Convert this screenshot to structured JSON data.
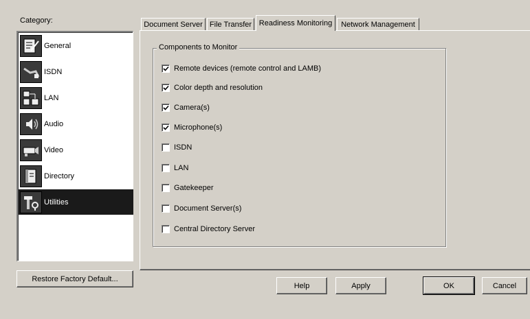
{
  "category": {
    "label": "Category:",
    "items": [
      {
        "label": "General",
        "icon": "general-icon",
        "selected": false
      },
      {
        "label": "ISDN",
        "icon": "isdn-icon",
        "selected": false
      },
      {
        "label": "LAN",
        "icon": "lan-icon",
        "selected": false
      },
      {
        "label": "Audio",
        "icon": "audio-icon",
        "selected": false
      },
      {
        "label": "Video",
        "icon": "video-icon",
        "selected": false
      },
      {
        "label": "Directory",
        "icon": "directory-icon",
        "selected": false
      },
      {
        "label": "Utilities",
        "icon": "utilities-icon",
        "selected": true
      }
    ],
    "restore_label": "Restore Factory Default..."
  },
  "tabs": [
    {
      "label": "Document Server",
      "active": false
    },
    {
      "label": "File Transfer",
      "active": false
    },
    {
      "label": "Readiness Monitoring",
      "active": true
    },
    {
      "label": "Network Management",
      "active": false
    }
  ],
  "group": {
    "title": "Components to Monitor",
    "items": [
      {
        "label": "Remote devices (remote control and LAMB)",
        "checked": true
      },
      {
        "label": "Color depth and resolution",
        "checked": true
      },
      {
        "label": "Camera(s)",
        "checked": true
      },
      {
        "label": "Microphone(s)",
        "checked": true
      },
      {
        "label": "ISDN",
        "checked": false
      },
      {
        "label": "LAN",
        "checked": false
      },
      {
        "label": "Gatekeeper",
        "checked": false
      },
      {
        "label": "Document Server(s)",
        "checked": false
      },
      {
        "label": "Central Directory Server",
        "checked": false
      }
    ]
  },
  "buttons": {
    "help": "Help",
    "apply": "Apply",
    "ok": "OK",
    "cancel": "Cancel"
  },
  "colors": {
    "face": "#d4d0c8",
    "selection": "#1a1a1a"
  }
}
